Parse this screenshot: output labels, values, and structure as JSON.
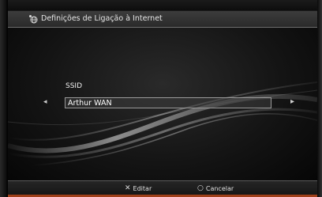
{
  "window": {
    "title": "Definições de Ligação à Internet",
    "title_icon": "network-globe-icon"
  },
  "form": {
    "field_label": "SSID",
    "field_value": "Arthur WAN",
    "left_arrow": "◂",
    "right_arrow": "▸"
  },
  "footer": {
    "edit_symbol": "✕",
    "edit_label": "Editar",
    "cancel_symbol": "○",
    "cancel_label": "Cancelar"
  }
}
